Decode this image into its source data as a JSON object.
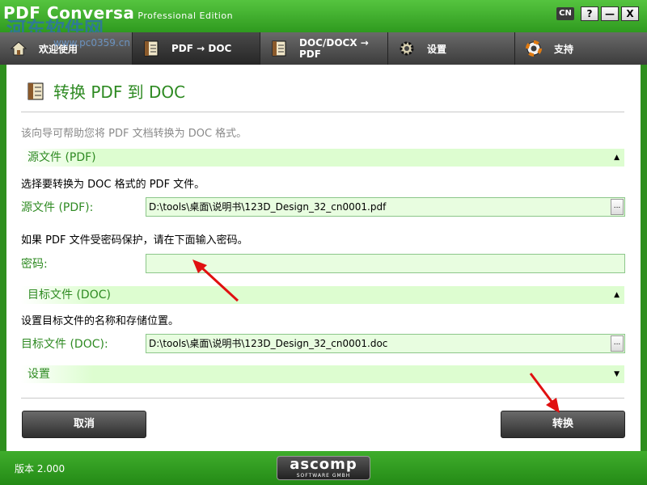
{
  "window": {
    "app_name": "PDF Conversa",
    "edition": "Professional Edition",
    "watermark": "河东软件网",
    "watermark_url": "www.pc0359.cn",
    "language": "CN",
    "help_label": "?",
    "minimize_label": "—",
    "close_label": "X"
  },
  "tabs": [
    {
      "label": "欢迎使用",
      "icon": "home-icon"
    },
    {
      "label": "PDF → DOC",
      "icon": "document-icon"
    },
    {
      "label": "DOC/DOCX → PDF",
      "icon": "document-icon"
    },
    {
      "label": "设置",
      "icon": "gear-icon"
    },
    {
      "label": "支持",
      "icon": "lifebuoy-icon"
    }
  ],
  "page": {
    "title": "转换 PDF 到 DOC",
    "intro": "该向导可帮助您将 PDF 文档转换为 DOC 格式。"
  },
  "source": {
    "section_title": "源文件 (PDF)",
    "description": "选择要转换为 DOC 格式的 PDF 文件。",
    "field_label": "源文件 (PDF):",
    "value": "D:\\tools\\桌面\\说明书\\123D_Design_32_cn0001.pdf",
    "password_hint": "如果 PDF 文件受密码保护，请在下面输入密码。",
    "password_label": "密码:",
    "password_value": ""
  },
  "target": {
    "section_title": "目标文件 (DOC)",
    "description": "设置目标文件的名称和存储位置。",
    "field_label": "目标文件 (DOC):",
    "value": "D:\\tools\\桌面\\说明书\\123D_Design_32_cn0001.doc"
  },
  "settings": {
    "section_title": "设置"
  },
  "browse_label": "...",
  "buttons": {
    "cancel": "取消",
    "convert": "转换"
  },
  "footer": {
    "version": "版本 2.000",
    "brand": "ascomp",
    "brand_sub": "SOFTWARE GMBH"
  },
  "colors": {
    "accent_green": "#2e8a22",
    "field_bg": "#e8fde0",
    "arrow_red": "#e01010"
  }
}
